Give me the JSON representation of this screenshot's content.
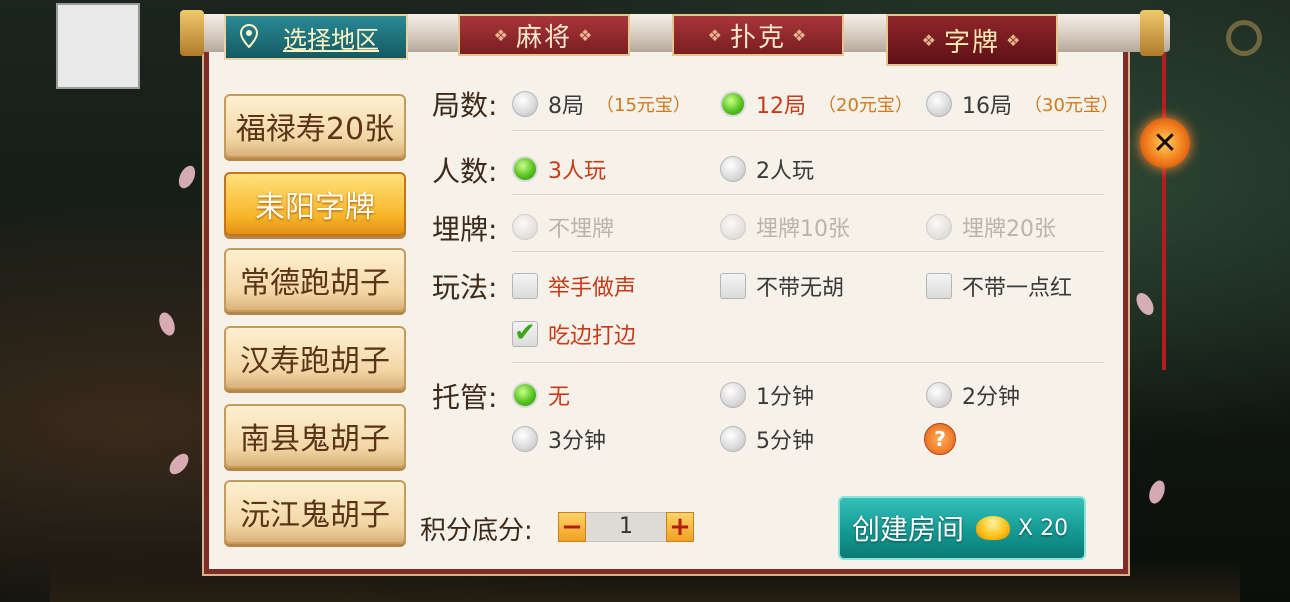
{
  "header": {
    "region_tab": "选择地区",
    "categories": [
      {
        "label": "麻将",
        "active": false
      },
      {
        "label": "扑克",
        "active": false
      },
      {
        "label": "字牌",
        "active": true
      }
    ]
  },
  "regions": [
    {
      "label": "福禄寿20张",
      "active": false
    },
    {
      "label": "耒阳字牌",
      "active": true
    },
    {
      "label": "常德跑胡子",
      "active": false
    },
    {
      "label": "汉寿跑胡子",
      "active": false
    },
    {
      "label": "南县鬼胡子",
      "active": false
    },
    {
      "label": "沅江鬼胡子",
      "active": false
    }
  ],
  "rounds": {
    "label": "局数:",
    "options": [
      {
        "label": "8局",
        "price": "（15元宝）",
        "selected": false
      },
      {
        "label": "12局",
        "price": "（20元宝）",
        "selected": true
      },
      {
        "label": "16局",
        "price": "（30元宝）",
        "selected": false
      }
    ]
  },
  "players": {
    "label": "人数:",
    "options": [
      {
        "label": "3人玩",
        "selected": true
      },
      {
        "label": "2人玩",
        "selected": false
      }
    ]
  },
  "bury": {
    "label": "埋牌:",
    "options": [
      {
        "label": "不埋牌",
        "disabled": true
      },
      {
        "label": "埋牌10张",
        "disabled": true
      },
      {
        "label": "埋牌20张",
        "disabled": true
      }
    ]
  },
  "rules": {
    "label": "玩法:",
    "options": [
      {
        "label": "举手做声",
        "checked": false
      },
      {
        "label": "不带无胡",
        "checked": false
      },
      {
        "label": "不带一点红",
        "checked": false
      },
      {
        "label": "吃边打边",
        "checked": true
      }
    ]
  },
  "auto": {
    "label": "托管:",
    "options": [
      {
        "label": "无",
        "selected": true
      },
      {
        "label": "1分钟",
        "selected": false
      },
      {
        "label": "2分钟",
        "selected": false
      },
      {
        "label": "3分钟",
        "selected": false
      },
      {
        "label": "5分钟",
        "selected": false
      }
    ],
    "help": "?"
  },
  "score": {
    "label": "积分底分:",
    "minus": "−",
    "value": "1",
    "plus": "+"
  },
  "create": {
    "label": "创建房间",
    "cost": "X 20"
  },
  "close_label": "✕",
  "colors": {
    "accent_red": "#7f2b28",
    "selected_text": "#c43c1a",
    "teal_button": "#149a94",
    "gold_button": "#f8b52a"
  }
}
